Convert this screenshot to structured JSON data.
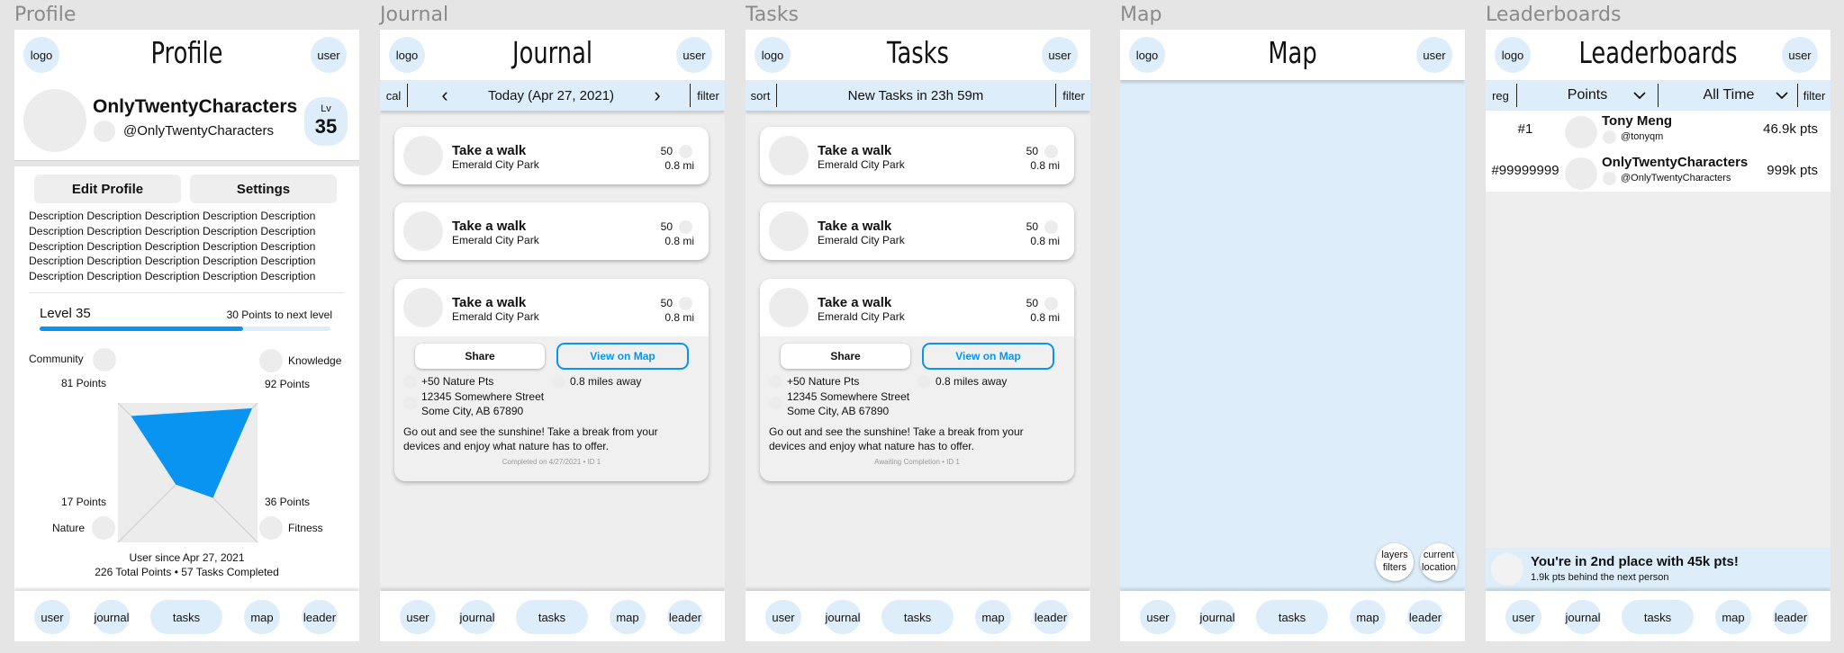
{
  "frames": {
    "profile": "Profile",
    "journal": "Journal",
    "tasks": "Tasks",
    "map": "Map",
    "leaderboards": "Leaderboards"
  },
  "common": {
    "logo": "logo",
    "user": "user",
    "nav": [
      "user",
      "journal",
      "tasks",
      "map",
      "leader"
    ]
  },
  "profile": {
    "title": "Profile",
    "display_name": "OnlyTwentyCharacters",
    "handle": "@OnlyTwentyCharacters",
    "lv_label": "Lv",
    "lv_value": "35",
    "edit_button": "Edit Profile",
    "settings_button": "Settings",
    "description_lines": [
      "Description Description Description Description Description",
      "Description Description Description Description Description",
      "Description Description Description Description Description",
      "Description Description Description Description Description",
      "Description Description Description Description Description"
    ],
    "level_label": "Level 35",
    "next_level": "30 Points to next level",
    "level_progress": 0.7,
    "radar": {
      "community": "Community",
      "community_pts": "81 Points",
      "knowledge": "Knowledge",
      "knowledge_pts": "92 Points",
      "nature": "Nature",
      "nature_pts": "17 Points",
      "fitness": "Fitness",
      "fitness_pts": "36 Points",
      "values": {
        "community": 81,
        "knowledge": 92,
        "nature": 17,
        "fitness": 36
      },
      "color": "#0a94f2"
    },
    "since": "User since Apr 27, 2021",
    "totals": "226 Total Points • 57 Tasks Completed"
  },
  "journal": {
    "title": "Journal",
    "cal": "cal",
    "date": "Today (Apr 27, 2021)",
    "prev": "‹",
    "next": "›",
    "filter": "filter",
    "detail_footer": "Completed on 4/27/2021 • ID 1"
  },
  "tasks": {
    "title": "Tasks",
    "sort": "sort",
    "countdown": "New Tasks in 23h 59m",
    "filter": "filter",
    "detail_footer": "Awaiting Completion • ID 1"
  },
  "task_card": {
    "name": "Take a walk",
    "location": "Emerald City Park",
    "points": "50",
    "distance": "0.8 mi",
    "share": "Share",
    "view_map": "View on Map",
    "nature_pts": "+50 Nature Pts",
    "miles_away": "0.8 miles away",
    "address_1": "12345 Somewhere Street",
    "address_2": "Some City, AB 67890",
    "desc_1": "Go out and see the sunshine! Take a break from your",
    "desc_2": "devices and enjoy what nature has to offer."
  },
  "map": {
    "title": "Map",
    "layers_1": "layers",
    "layers_2": "filters",
    "current_1": "current",
    "current_2": "location",
    "map_color": "#ddeefa"
  },
  "leader": {
    "title": "Leaderboards",
    "reg": "reg",
    "points_select": "Points",
    "time_select": "All Time",
    "filter": "filter",
    "rows": [
      {
        "rank": "#1",
        "name": "Tony Meng",
        "handle": "@tonyqm",
        "pts": "46.9k pts"
      },
      {
        "rank": "#99999999",
        "name": "OnlyTwentyCharacters",
        "handle": "@OnlyTwentyCharacters",
        "pts": "999k pts"
      }
    ],
    "place": "You're in 2nd place with 45k pts!",
    "behind": "1.9k pts behind the next person"
  },
  "colors": {
    "accent": "#0a94f2",
    "light_blue": "#ddeefa",
    "grey_bg": "#eeeeee"
  }
}
